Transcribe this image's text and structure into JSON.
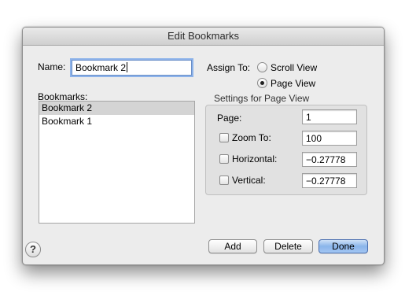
{
  "window": {
    "title": "Edit Bookmarks"
  },
  "name_field": {
    "label": "Name:",
    "value": "Bookmark  2"
  },
  "assign_to": {
    "label": "Assign To:",
    "options": [
      {
        "label": "Scroll View",
        "selected": false
      },
      {
        "label": "Page View",
        "selected": true
      }
    ]
  },
  "bookmarks": {
    "label": "Bookmarks:",
    "items": [
      {
        "label": "Bookmark  2",
        "selected": true
      },
      {
        "label": "Bookmark  1",
        "selected": false
      }
    ]
  },
  "settings": {
    "title": "Settings for Page View",
    "page": {
      "label": "Page:",
      "value": "1"
    },
    "zoom": {
      "label": "Zoom To:",
      "value": "100",
      "checked": false
    },
    "horizontal": {
      "label": "Horizontal:",
      "value": "−0.27778",
      "checked": false
    },
    "vertical": {
      "label": "Vertical:",
      "value": "−0.27778",
      "checked": false
    }
  },
  "buttons": {
    "add": "Add",
    "delete": "Delete",
    "done": "Done",
    "help": "?"
  }
}
